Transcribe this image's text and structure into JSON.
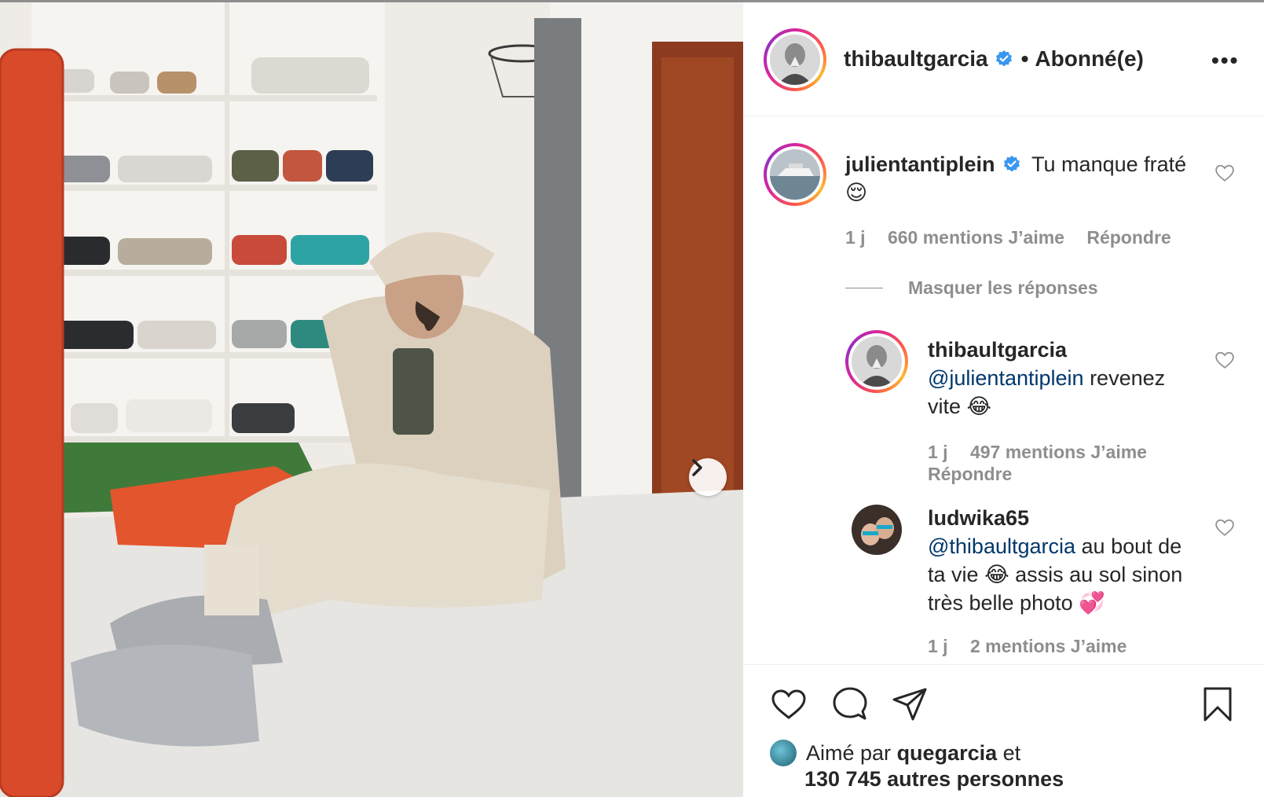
{
  "post": {
    "author": "thibaultgarcia",
    "separator": "•",
    "follow_state": "Abonné(e)",
    "more_label": "•••"
  },
  "comments": [
    {
      "username": "julientantiplein",
      "text": "Tu manque fraté",
      "emoji": "😌",
      "time": "1 j",
      "likes": "660 mentions J’aime",
      "reply": "Répondre",
      "hide_replies": "Masquer les réponses"
    }
  ],
  "replies": [
    {
      "username": "thibaultgarcia",
      "mention": "@julientantiplein",
      "text_a": "revenez",
      "text_b": "vite",
      "emoji": "😂",
      "time": "1 j",
      "likes": "497 mentions J’aime",
      "reply": "Répondre"
    },
    {
      "username": "ludwika65",
      "mention": "@thibaultgarcia",
      "text_a": "au bout de",
      "text_b": "ta vie",
      "emoji_a": "😂",
      "text_c": "assis au sol sinon",
      "text_d": "très belle photo",
      "emoji_b": "💞",
      "time": "1 j",
      "likes": "2 mentions J’aime"
    }
  ],
  "likes": {
    "prefix": "Aimé par",
    "user": "quegarcia",
    "conj": "et",
    "others": "130 745 autres personnes"
  },
  "icons": [
    "verified-badge-icon",
    "heart-icon",
    "comment-icon",
    "share-icon",
    "bookmark-icon",
    "chevron-right-icon",
    "more-icon"
  ],
  "colors": {
    "verified": "#3897f0",
    "mention": "#00376b",
    "muted": "#8e8e8e"
  }
}
